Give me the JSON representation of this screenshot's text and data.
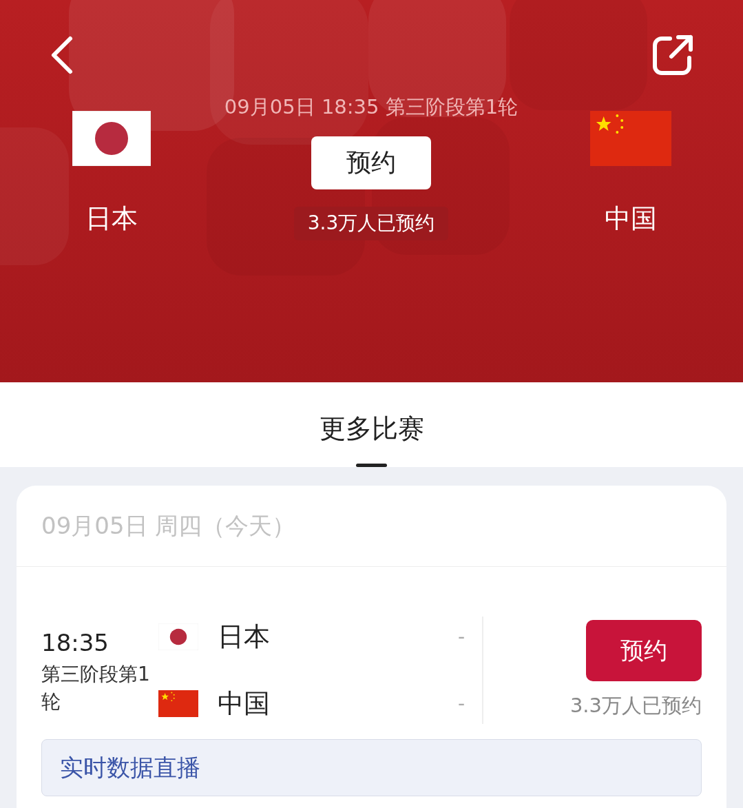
{
  "header": {
    "datetime": "09月05日 18:35 第三阶段第1轮",
    "home": {
      "name": "日本",
      "flag": {
        "kind": "japan"
      }
    },
    "away": {
      "name": "中国",
      "flag": {
        "kind": "china"
      }
    },
    "reserve_button": "预约",
    "reserve_count": "3.3万人已预约"
  },
  "tab": {
    "label": "更多比赛",
    "selected": true
  },
  "day": {
    "date": "09月05日 周四（今天）"
  },
  "matches": [
    {
      "time": "18:35",
      "stage": "第三阶段第1轮",
      "teams": [
        {
          "name": "日本",
          "flag": {
            "kind": "japan"
          },
          "score": "-"
        },
        {
          "name": "中国",
          "flag": {
            "kind": "china"
          },
          "score": "-"
        }
      ],
      "button": "预约",
      "count": "3.3万人已预约"
    }
  ],
  "live_link": "实时数据直播"
}
